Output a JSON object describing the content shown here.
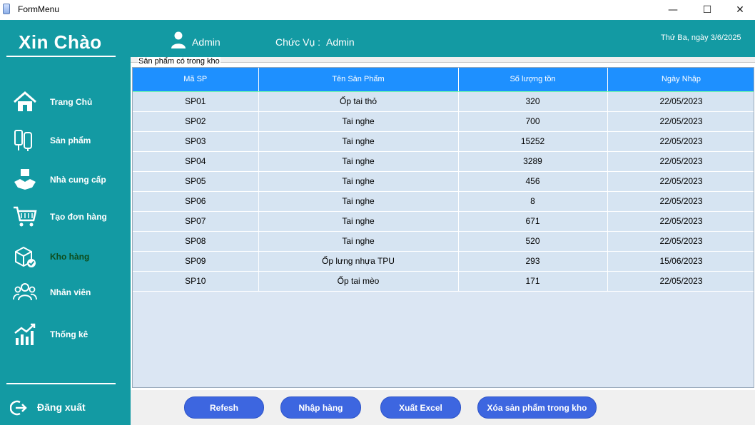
{
  "window": {
    "title": "FormMenu"
  },
  "header": {
    "brand": "Xin Chào",
    "user_name": "Admin",
    "role_label": "Chức Vụ :",
    "role_value": "Admin",
    "date": "Thứ Ba, ngày 3/6/2025"
  },
  "sidebar": {
    "items": [
      {
        "label": "Trang Chủ",
        "icon": "home-icon"
      },
      {
        "label": "Sản phẩm",
        "icon": "product-icon"
      },
      {
        "label": "Nhà cung cấp",
        "icon": "supplier-icon"
      },
      {
        "label": "Tạo đơn hàng",
        "icon": "cart-icon"
      },
      {
        "label": "Kho hàng",
        "icon": "warehouse-icon",
        "active": true
      },
      {
        "label": "Nhân viên",
        "icon": "staff-icon"
      },
      {
        "label": "Thống kê",
        "icon": "chart-icon"
      }
    ],
    "logout_label": "Đăng xuất"
  },
  "inventory": {
    "group_title": "Sản phẩm có trong kho",
    "columns": [
      "Mã SP",
      "Tên Sản Phẩm",
      "Số lượng tồn",
      "Ngày Nhập"
    ],
    "rows": [
      [
        "SP01",
        "Ốp tai thỏ",
        "320",
        "22/05/2023"
      ],
      [
        "SP02",
        "Tai nghe",
        "700",
        "22/05/2023"
      ],
      [
        "SP03",
        "Tai nghe",
        "15252",
        "22/05/2023"
      ],
      [
        "SP04",
        "Tai nghe",
        "3289",
        "22/05/2023"
      ],
      [
        "SP05",
        "Tai nghe",
        "456",
        "22/05/2023"
      ],
      [
        "SP06",
        "Tai nghe",
        "8",
        "22/05/2023"
      ],
      [
        "SP07",
        "Tai nghe",
        "671",
        "22/05/2023"
      ],
      [
        "SP08",
        "Tai nghe",
        "520",
        "22/05/2023"
      ],
      [
        "SP09",
        "Ốp lưng nhựa TPU",
        "293",
        "15/06/2023"
      ],
      [
        "SP10",
        "Ốp tai mèo",
        "171",
        "22/05/2023"
      ]
    ]
  },
  "actions": {
    "refresh": "Refesh",
    "import": "Nhập hàng",
    "export_excel": "Xuất Excel",
    "delete_stock": "Xóa sản phẩm trong kho"
  },
  "colors": {
    "teal": "#139aa3",
    "header_blue": "#1e90ff",
    "button_blue": "#3d66e0"
  }
}
